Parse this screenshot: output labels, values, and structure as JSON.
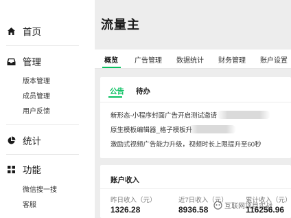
{
  "sidebar": {
    "home": {
      "label": "首页",
      "icon": "home-icon"
    },
    "manage": {
      "label": "管理",
      "icon": "inbox-icon",
      "items": [
        "版本管理",
        "成员管理",
        "用户反馈"
      ]
    },
    "stats": {
      "label": "统计",
      "icon": "pie-chart-icon"
    },
    "features": {
      "label": "功能",
      "icon": "grid-icon",
      "items": [
        "微信搜一搜",
        "客服"
      ]
    }
  },
  "page": {
    "title": "流量主"
  },
  "tabs": [
    "概览",
    "广告管理",
    "数据统计",
    "财务管理",
    "账户设置"
  ],
  "notice": {
    "tabs": [
      "公告",
      "待办"
    ],
    "items": [
      "新形态-小程序封面广告开启测试邀请",
      "原生模板编辑器_格子模板升",
      "激励式视频广告能力升级，视频时长上限提升至60秒"
    ]
  },
  "income": {
    "title": "账户收入",
    "stats": [
      {
        "label": "昨日收入（元）",
        "value": "1326.28"
      },
      {
        "label": "近7日收入（元）",
        "value": "8936.58"
      },
      {
        "label": "累计收入（元）",
        "value": "116256.96"
      }
    ]
  },
  "watermark": {
    "text": "互联网项目实战"
  },
  "colors": {
    "accent": "#07c160",
    "background": "#ededed"
  }
}
